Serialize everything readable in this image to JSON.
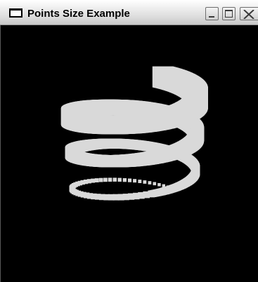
{
  "window": {
    "title": "Points Size Example",
    "icons": {
      "app": "window-icon",
      "minimize": "minimize-icon",
      "maximize": "maximize-icon",
      "close": "close-icon"
    }
  },
  "scene": {
    "description_shape": "spiral-of-points",
    "background_color": "#000000",
    "point_color": "#d9d9d9"
  }
}
